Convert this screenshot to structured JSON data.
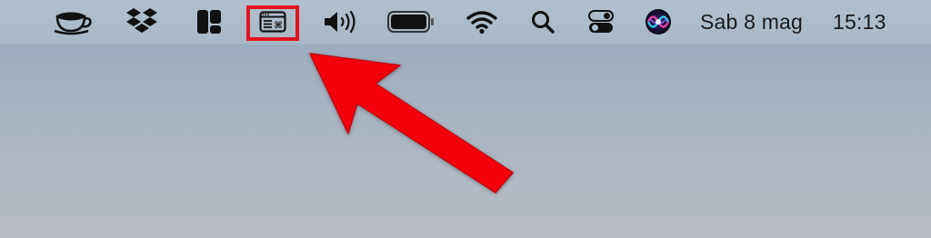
{
  "menubar": {
    "icons": [
      {
        "name": "coffee-cup-icon"
      },
      {
        "name": "dropbox-icon"
      },
      {
        "name": "layout-grid-icon"
      },
      {
        "name": "keyboard-shortcuts-window-icon",
        "highlighted": true
      },
      {
        "name": "volume-icon"
      },
      {
        "name": "battery-icon",
        "level": 1.0
      },
      {
        "name": "wifi-icon"
      },
      {
        "name": "spotlight-search-icon"
      },
      {
        "name": "control-center-icon"
      },
      {
        "name": "siri-icon"
      }
    ],
    "date": "Sab 8 mag",
    "time": "15:13"
  },
  "annotation": {
    "highlight_color": "#e3131d",
    "arrow_color": "#f4000b"
  }
}
